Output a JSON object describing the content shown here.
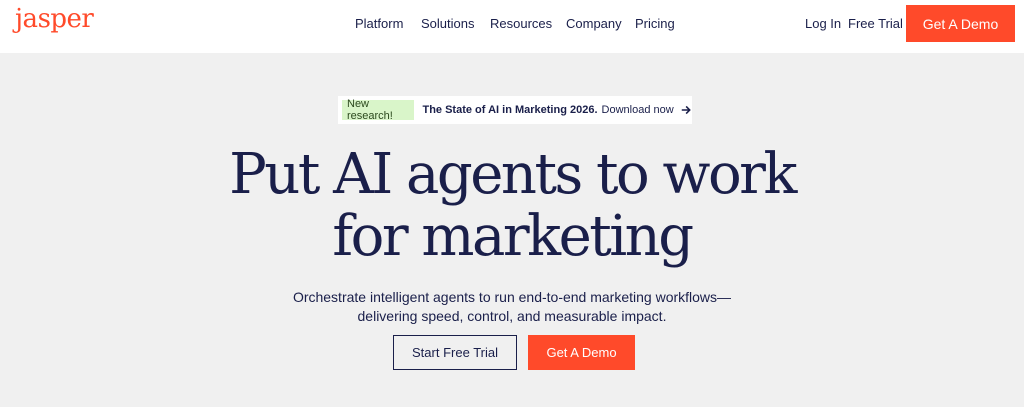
{
  "brand": {
    "logo": "jasper",
    "accent_color": "#ff4a2a",
    "text_color": "#1a1f4a"
  },
  "nav": {
    "links": [
      "Platform",
      "Solutions",
      "Resources",
      "Company",
      "Pricing"
    ],
    "login": "Log In",
    "free_trial": "Free Trial",
    "demo": "Get A Demo"
  },
  "banner": {
    "badge": "New research!",
    "title": "The State of AI in Marketing 2026.",
    "link": "Download now",
    "icon": "arrow-right-icon"
  },
  "hero": {
    "headline_line1": "Put AI agents to work",
    "headline_line2": "for marketing",
    "subheadline_line1": "Orchestrate intelligent agents to run end-to-end marketing workflows—",
    "subheadline_line2": "delivering speed, control, and measurable impact.",
    "trial_button": "Start Free Trial",
    "demo_button": "Get A Demo"
  }
}
